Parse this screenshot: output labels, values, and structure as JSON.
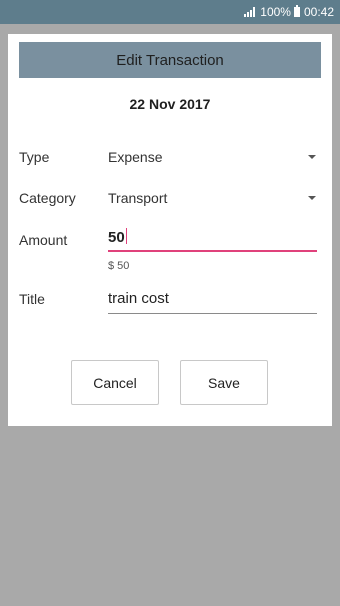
{
  "status_bar": {
    "battery": "100%",
    "time": "00:42"
  },
  "dialog": {
    "title": "Edit Transaction",
    "date": "22 Nov 2017",
    "type": {
      "label": "Type",
      "value": "Expense"
    },
    "category": {
      "label": "Category",
      "value": "Transport"
    },
    "amount": {
      "label": "Amount",
      "value": "50",
      "hint": "$ 50"
    },
    "title_field": {
      "label": "Title",
      "value": "train cost"
    },
    "buttons": {
      "cancel": "Cancel",
      "save": "Save"
    }
  },
  "colors": {
    "status_bar": "#5e7d8c",
    "header": "#7a909f",
    "accent": "#e0417b",
    "backdrop": "#a9a9a9"
  },
  "icons": [
    "signal-icon",
    "battery-icon",
    "dropdown-caret-icon"
  ]
}
